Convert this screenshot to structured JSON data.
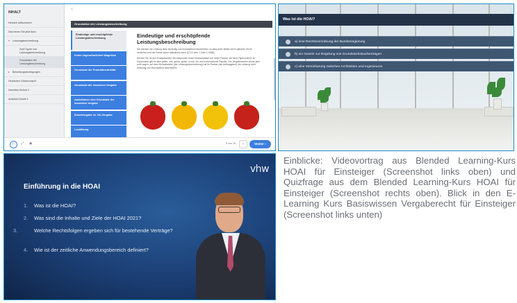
{
  "elearning": {
    "sidebar": {
      "heading": "INHALT",
      "items": [
        {
          "label": "Herzlich willkommen!",
          "type": "item"
        },
        {
          "label": "Das lernen Sie jetzt dazu",
          "type": "item"
        },
        {
          "label": "Leistungsbeschreibung",
          "type": "group-open"
        },
        {
          "label": "Zwei Typen von Leistungsbeschreibung",
          "type": "sub"
        },
        {
          "label": "Grundsätze der Leistungsbeschreibung",
          "type": "sub-active"
        },
        {
          "label": "Bewertungsbedingungen",
          "type": "group-closed"
        },
        {
          "label": "Herzlichen Glückwunsch!",
          "type": "item"
        },
        {
          "label": "Überblick Einheit 2",
          "type": "item"
        },
        {
          "label": "Ausblick Einheit 3",
          "type": "item"
        }
      ]
    },
    "back_symbol": "<",
    "title_bar": "Grundsätze der Leistungsbeschreibung",
    "tabs": [
      "Eindeutige und erschöpfende Leistungsbeschreibung",
      "Keine ungewöhnlichen Wagnisse",
      "Grundsatz der Produktneutralität",
      "Grundsatz der losweisen Vergabe",
      "Ausnahmen vom Grundsatz der losweisen Vergabe",
      "Einzelvergabe vs. GU-Vergabe",
      "Losbildung"
    ],
    "content": {
      "title": "Eindeutige und erschöpfende Leistungsbeschreibung",
      "paragraph1": "Sie müssen die Leistung stets eindeutig und erschöpfend beschreiben, so dass jeder Bieter sie im gleichen Sinne verstehen und die Preise sicher kalkulieren kann (§ 121 Abs. 1 Satz 1 GWB).",
      "paragraph2": "Denken Sie an den Einkaufszettel: Sie bekommen einen Einkaufszettel von Ihrem Partner, auf dem Paprika steht. Im Supermarkt gibt es aber gelbe, rote, grüne, spitze, runde, bio und konventionelle Paprika. Der Vergaberechter würde jetzt wohl sagen, auf dem Einkaufszettel (der Leistungsbeschreibung) hat Ihr Partner (der Auftraggeber) die Leistung nicht eindeutig und erschöpfend beschrieben."
    },
    "pepper_colors": [
      "#c9201d",
      "#f2b705",
      "#f2c20a",
      "#c4221a"
    ],
    "footer": {
      "play_symbol": "▷",
      "expand_symbol": "⤢",
      "eye_symbol": "◉",
      "pager": "5 von 15",
      "prev_symbol": "‹",
      "next_label": "Weiter"
    }
  },
  "quiz": {
    "question": "Was ist die HOAI?",
    "answers": [
      "a) eine Rechtsverordnung der Bundesregierung",
      "b) ein Gesetz zur Regelung von Grundstückskaufverträgen",
      "c) eine Vereinbarung zwischen Architekten und Ingenieuren"
    ]
  },
  "video": {
    "logo": "vhw",
    "title": "Einführung in die HOAI",
    "items": [
      {
        "num": "1.",
        "text": "Was ist die HOAI?"
      },
      {
        "num": "2.",
        "text": "Was sind die Inhalte und Ziele der HOAI 2021?"
      },
      {
        "num": "3.",
        "text": "Welche Rechtsfolgen ergeben sich für bestehende Verträge?"
      },
      {
        "num": "4.",
        "text": "Wie ist der zeitliche Anwendungsbereich definiert?"
      }
    ]
  },
  "caption": "Einblicke: Videovortrag aus Blended Learning-Kurs HOAI für Einsteiger (Screenshot links oben) und Quizfrage aus dem Blended Learning-Kurs HOAI für Einsteiger (Screenshot rechts oben). Blick in den E-Learning Kurs Basiswissen Vergaberecht für Einsteiger (Screenshot links unten)"
}
